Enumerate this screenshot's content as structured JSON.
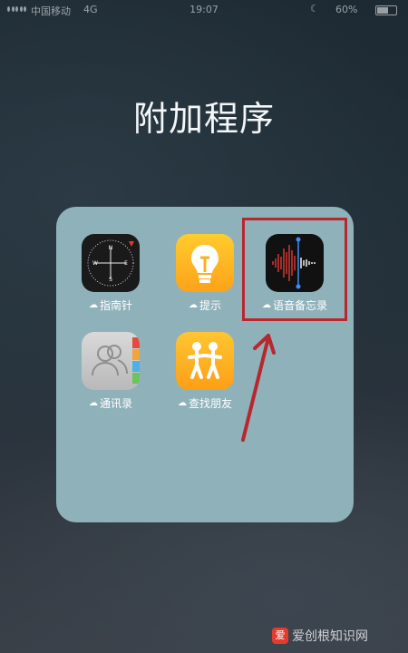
{
  "status_bar": {
    "carrier": "中国移动",
    "network": "4G",
    "time": "19:07",
    "battery_percent": "60%"
  },
  "folder": {
    "title": "附加程序",
    "apps": [
      {
        "label": "指南针",
        "icon": "compass-icon"
      },
      {
        "label": "提示",
        "icon": "lightbulb-icon"
      },
      {
        "label": "语音备忘录",
        "icon": "voice-memo-waveform-icon"
      },
      {
        "label": "通讯录",
        "icon": "contacts-icon"
      },
      {
        "label": "查找朋友",
        "icon": "find-friends-icon"
      }
    ]
  },
  "annotation": {
    "highlight_color": "#b8272d",
    "target_app": "语音备忘录"
  },
  "watermark": {
    "text": "爱创根知识网"
  },
  "colors": {
    "folder_bg": "#8fb2ba",
    "annotation_red": "#b8272d"
  }
}
